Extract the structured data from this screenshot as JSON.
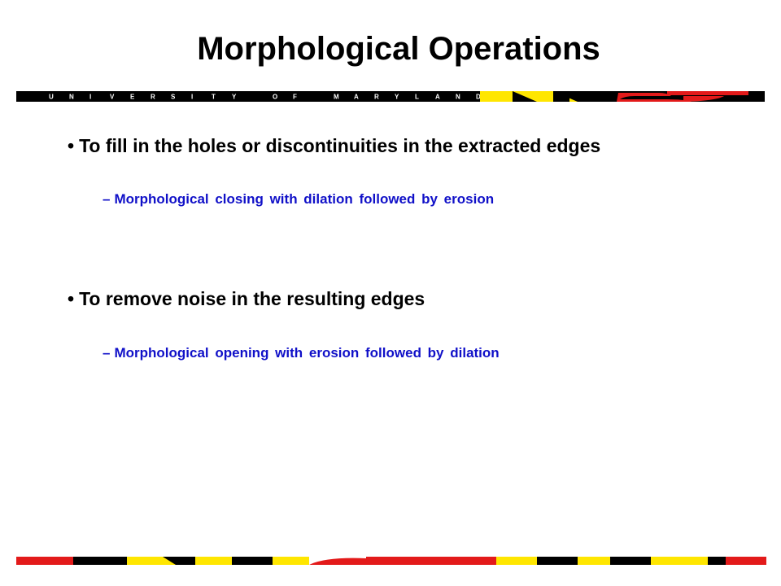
{
  "slide": {
    "title": "Morphological Operations",
    "banner_text": "UNIVERSITY OF MARYLAND",
    "colors": {
      "title": "#000000",
      "bullet": "#000000",
      "sub_bullet": "#1010c8",
      "banner_black": "#000000",
      "banner_yellow": "#ffe600",
      "banner_red": "#e31a1a",
      "banner_white": "#ffffff"
    }
  },
  "bullets": [
    {
      "marker": "•",
      "text": "To fill in the holes or discontinuities in the extracted edges",
      "sub": {
        "marker": "–",
        "text": "Morphological closing with dilation followed by erosion"
      }
    },
    {
      "marker": "•",
      "text": "To remove noise in the resulting edges",
      "sub": {
        "marker": "–",
        "text": "Morphological opening with erosion followed by dilation"
      }
    }
  ]
}
